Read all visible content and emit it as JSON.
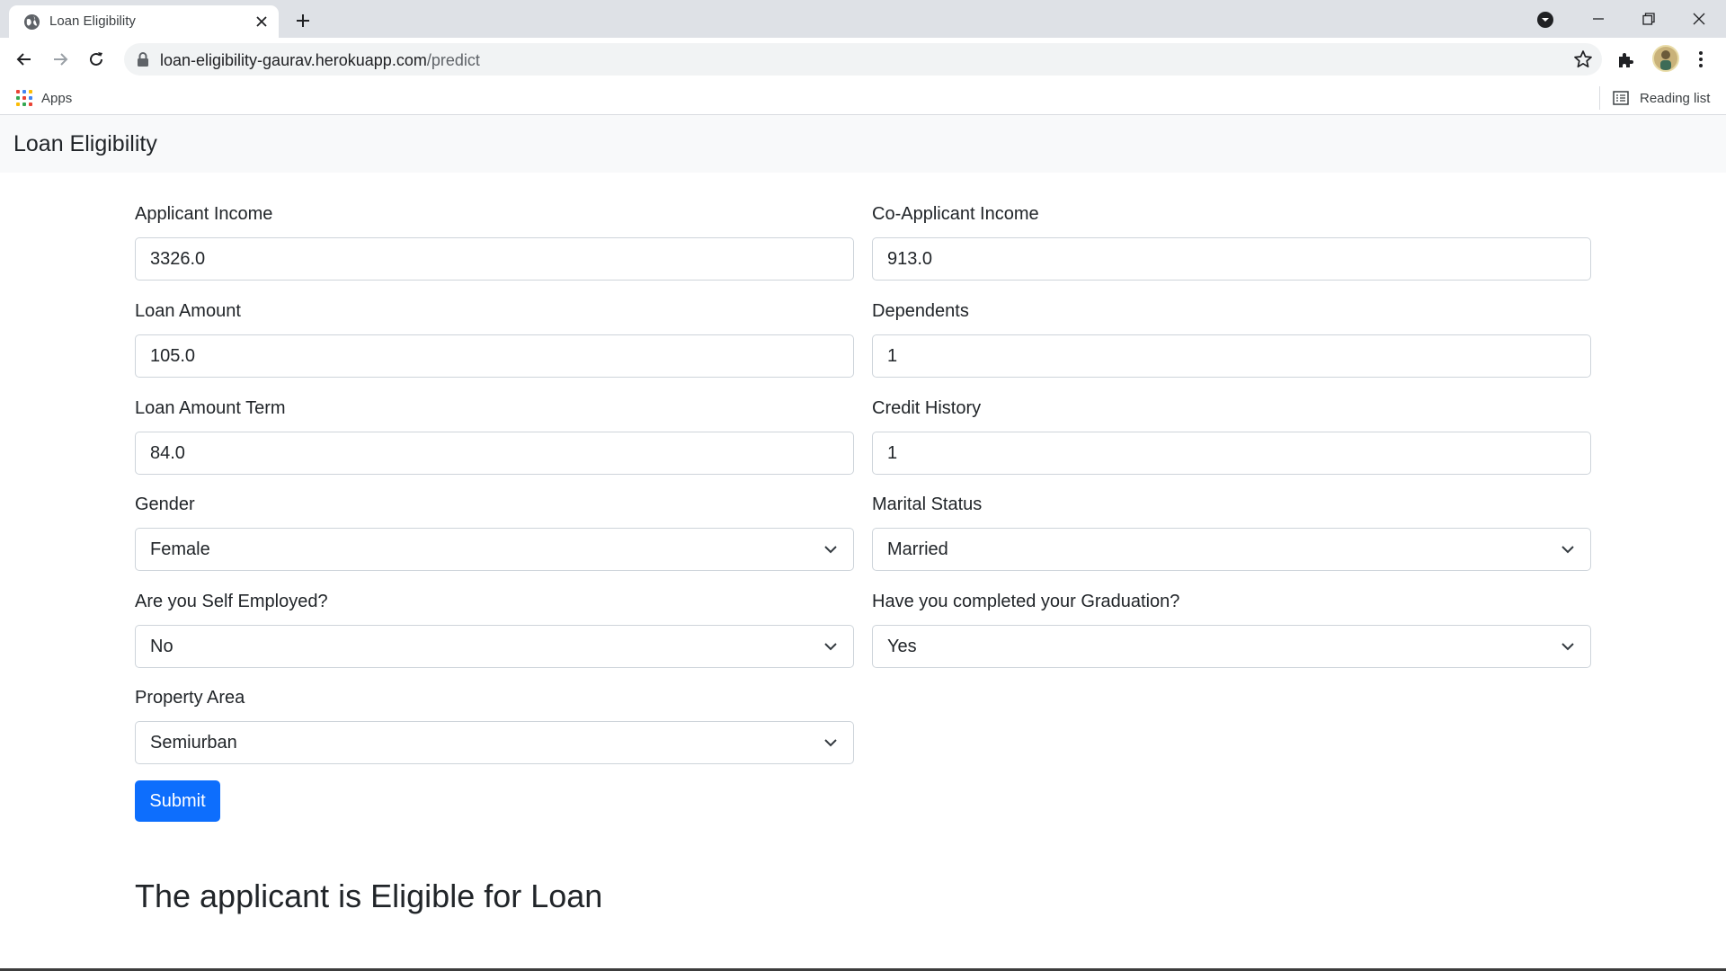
{
  "browser": {
    "tab_title": "Loan Eligibility",
    "url_host": "loan-eligibility-gaurav.herokuapp.com",
    "url_path": "/predict",
    "bookmarks": {
      "apps_label": "Apps",
      "reading_list_label": "Reading list"
    }
  },
  "page": {
    "brand": "Loan Eligibility",
    "fields": [
      {
        "label": "Applicant Income",
        "value": "3326.0",
        "kind": "input"
      },
      {
        "label": "Co-Applicant Income",
        "value": "913.0",
        "kind": "input"
      },
      {
        "label": "Loan Amount",
        "value": "105.0",
        "kind": "input"
      },
      {
        "label": "Dependents",
        "value": "1",
        "kind": "input"
      },
      {
        "label": "Loan Amount Term",
        "value": "84.0",
        "kind": "input"
      },
      {
        "label": "Credit History",
        "value": "1",
        "kind": "input"
      },
      {
        "label": "Gender",
        "value": "Female",
        "kind": "select"
      },
      {
        "label": "Marital Status",
        "value": "Married",
        "kind": "select"
      },
      {
        "label": "Are you Self Employed?",
        "value": "No",
        "kind": "select"
      },
      {
        "label": "Have you completed your Graduation?",
        "value": "Yes",
        "kind": "select"
      },
      {
        "label": "Property Area",
        "value": "Semiurban",
        "kind": "select"
      }
    ],
    "submit_label": "Submit",
    "result_text": "The applicant is Eligible for Loan"
  },
  "colors": {
    "primary_button": "#0d6efd",
    "navbar_bg": "#f8f9fa",
    "input_border": "#ced4da"
  }
}
